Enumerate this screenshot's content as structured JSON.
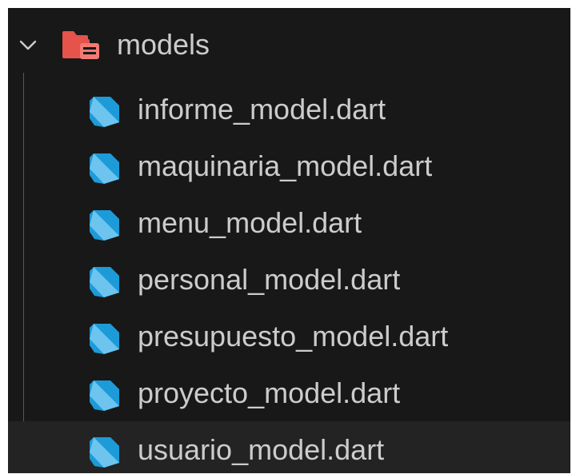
{
  "explorer": {
    "folder": {
      "name": "models",
      "expanded": true,
      "icon": "folder-open-icon",
      "icon_color": "#e5534b"
    },
    "file_icon": "dart-icon",
    "file_icon_color": "#1d9bd8",
    "files": [
      "informe_model.dart",
      "maquinaria_model.dart",
      "menu_model.dart",
      "personal_model.dart",
      "presupuesto_model.dart",
      "proyecto_model.dart",
      "usuario_model.dart"
    ],
    "hovered_file": "usuario_model.dart"
  }
}
